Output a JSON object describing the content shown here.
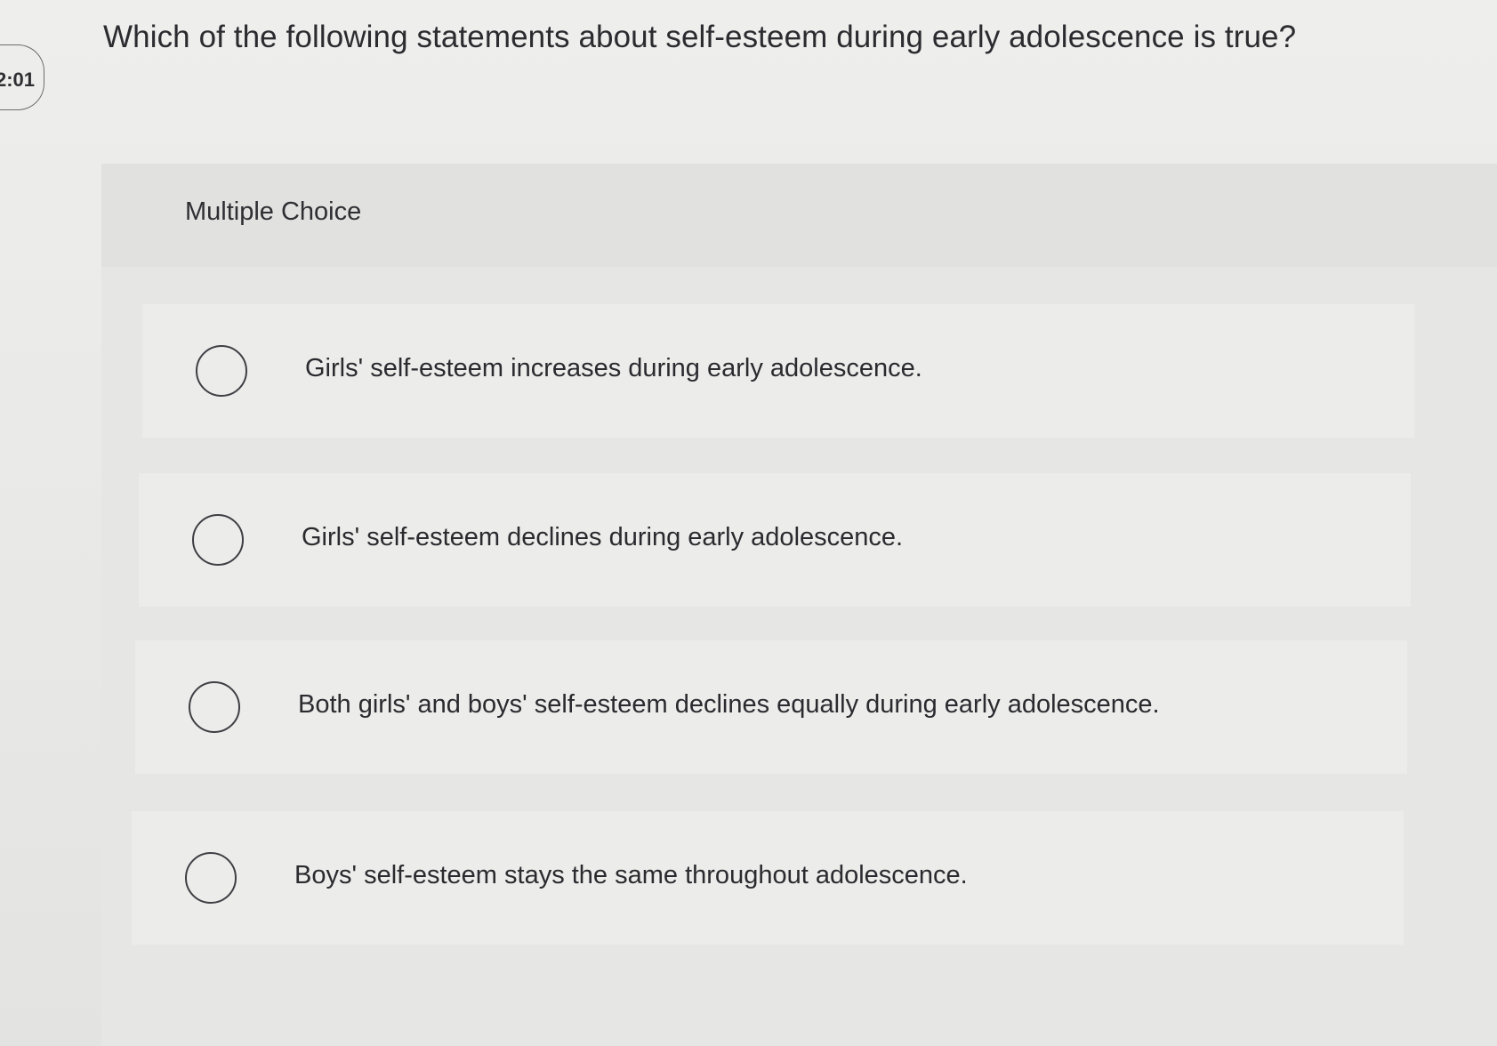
{
  "timer": {
    "text": "2:01"
  },
  "question": {
    "text": "Which of the following statements about self-esteem during early adolescence is true?"
  },
  "section": {
    "label": "Multiple Choice"
  },
  "choices": [
    {
      "text": "Girls' self-esteem increases during early adolescence."
    },
    {
      "text": "Girls' self-esteem declines during early adolescence."
    },
    {
      "text": "Both girls' and boys' self-esteem declines equally during early adolescence."
    },
    {
      "text": "Boys' self-esteem stays the same throughout adolescence."
    }
  ],
  "colors": {
    "background": "#e9e9e7",
    "panel": "#e1e1df",
    "choice_background": "#ececea",
    "text": "#2a2a2e",
    "radio_border": "#3e3e44"
  }
}
